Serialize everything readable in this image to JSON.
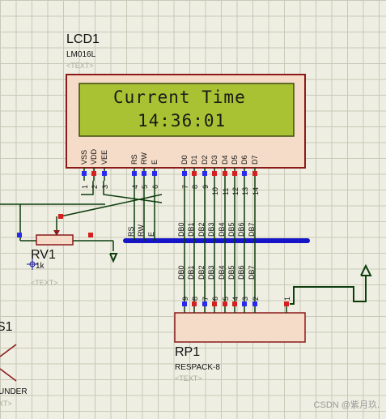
{
  "lcd": {
    "ref": "LCD1",
    "model": "LM016L",
    "text_placeholder": "<TEXT>",
    "line1": "Current Time",
    "line2": "14:36:01",
    "pins": [
      {
        "name": "VSS",
        "num": "1"
      },
      {
        "name": "VDD",
        "num": "2"
      },
      {
        "name": "VEE",
        "num": "3"
      },
      {
        "name": "RS",
        "num": "4"
      },
      {
        "name": "RW",
        "num": "5"
      },
      {
        "name": "E",
        "num": "6"
      },
      {
        "name": "D0",
        "num": "7"
      },
      {
        "name": "D1",
        "num": "8"
      },
      {
        "name": "D2",
        "num": "9"
      },
      {
        "name": "D3",
        "num": "10"
      },
      {
        "name": "D4",
        "num": "11"
      },
      {
        "name": "D5",
        "num": "12"
      },
      {
        "name": "D6",
        "num": "13"
      },
      {
        "name": "D7",
        "num": "14"
      }
    ],
    "net_labels": [
      "RS",
      "RW",
      "E",
      "DB0",
      "DB1",
      "DB2",
      "DB3",
      "DB4",
      "DB5",
      "DB6",
      "DB7"
    ]
  },
  "rv1": {
    "ref": "RV1",
    "value": "1k",
    "text_placeholder": "<TEXT>"
  },
  "rp1": {
    "ref": "RP1",
    "model": "RESPACK-8",
    "text_placeholder": "<TEXT>",
    "net_labels": [
      "DB0",
      "DB1",
      "DB2",
      "DB3",
      "DB4",
      "DB5",
      "DB6",
      "DB7"
    ],
    "pins": [
      "9",
      "8",
      "7",
      "6",
      "5",
      "4",
      "3",
      "2",
      "1"
    ]
  },
  "partial": {
    "ref_fragment": "S1",
    "label_fragment": "UNDER",
    "text_placeholder": "XT>"
  },
  "watermark": "CSDN @紫月玖.",
  "colors": {
    "background": "#eeeee2",
    "grid": "#c9c9b8",
    "component_fill": "#f5dcc8",
    "component_border": "#8b1a1a",
    "lcd_screen": "#a8c234",
    "wire": "#0d3d0d",
    "bus": "#1616c8",
    "pin_red": "#d42020",
    "pin_blue": "#2a2aee"
  }
}
